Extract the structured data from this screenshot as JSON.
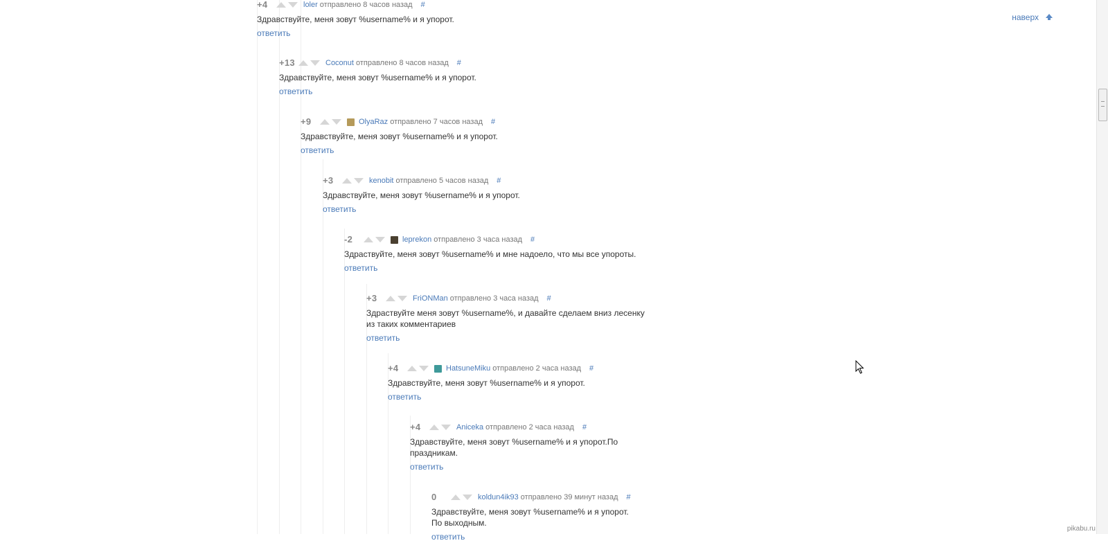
{
  "up_link": "наверх",
  "comments": [
    {
      "rating": "+4",
      "user": "loler",
      "posted": "отправлено 8 часов назад",
      "text": "Здравствуйте, меня зовут %username% и я упорот.",
      "avatar": ""
    },
    {
      "rating": "+13",
      "user": "Coconut",
      "posted": "отправлено 8 часов назад",
      "text": "Здравствуйте, меня зовут %username% и я упорот.",
      "avatar": ""
    },
    {
      "rating": "+9",
      "user": "OlyaRaz",
      "posted": "отправлено 7 часов назад",
      "text": "Здравствуйте, меня зовут %username% и я упорот.",
      "avatar": "#b59a5a"
    },
    {
      "rating": "+3",
      "user": "kenobit",
      "posted": "отправлено 5 часов назад",
      "text": "Здравствуйте, меня зовут %username% и я упорот.",
      "avatar": ""
    },
    {
      "rating": "-2",
      "user": "leprekon",
      "posted": "отправлено 3 часа назад",
      "text": "Здраствуйте, меня зовут %username% и мне надоело, что мы все упороты.",
      "avatar": "#4a4030"
    },
    {
      "rating": "+3",
      "user": "FriONMan",
      "posted": "отправлено 3 часа назад",
      "text": "Здраствуйте меня зовут %username%, и давайте сделаем вниз лесенку\nиз таких комментариев",
      "avatar": ""
    },
    {
      "rating": "+4",
      "user": "HatsuneMiku",
      "posted": "отправлено 2 часа назад",
      "text": "Здравствуйте, меня зовут %username% и я упорот.",
      "avatar": "#3f9a9a"
    },
    {
      "rating": "+4",
      "user": "Aniceka",
      "posted": "отправлено 2 часа назад",
      "text": "Здравствуйте, меня зовут %username% и я упорот.По\nпраздникам.",
      "avatar": ""
    },
    {
      "rating": "0",
      "user": "koldun4ik93",
      "posted": "отправлено 39 минут назад",
      "text": "Здравствуйте, меня зовут %username% и я упорот.\nПо выходным.",
      "avatar": ""
    }
  ],
  "reply_label": "ответить",
  "hash_label": "#",
  "watermark": "pikabu.ru"
}
